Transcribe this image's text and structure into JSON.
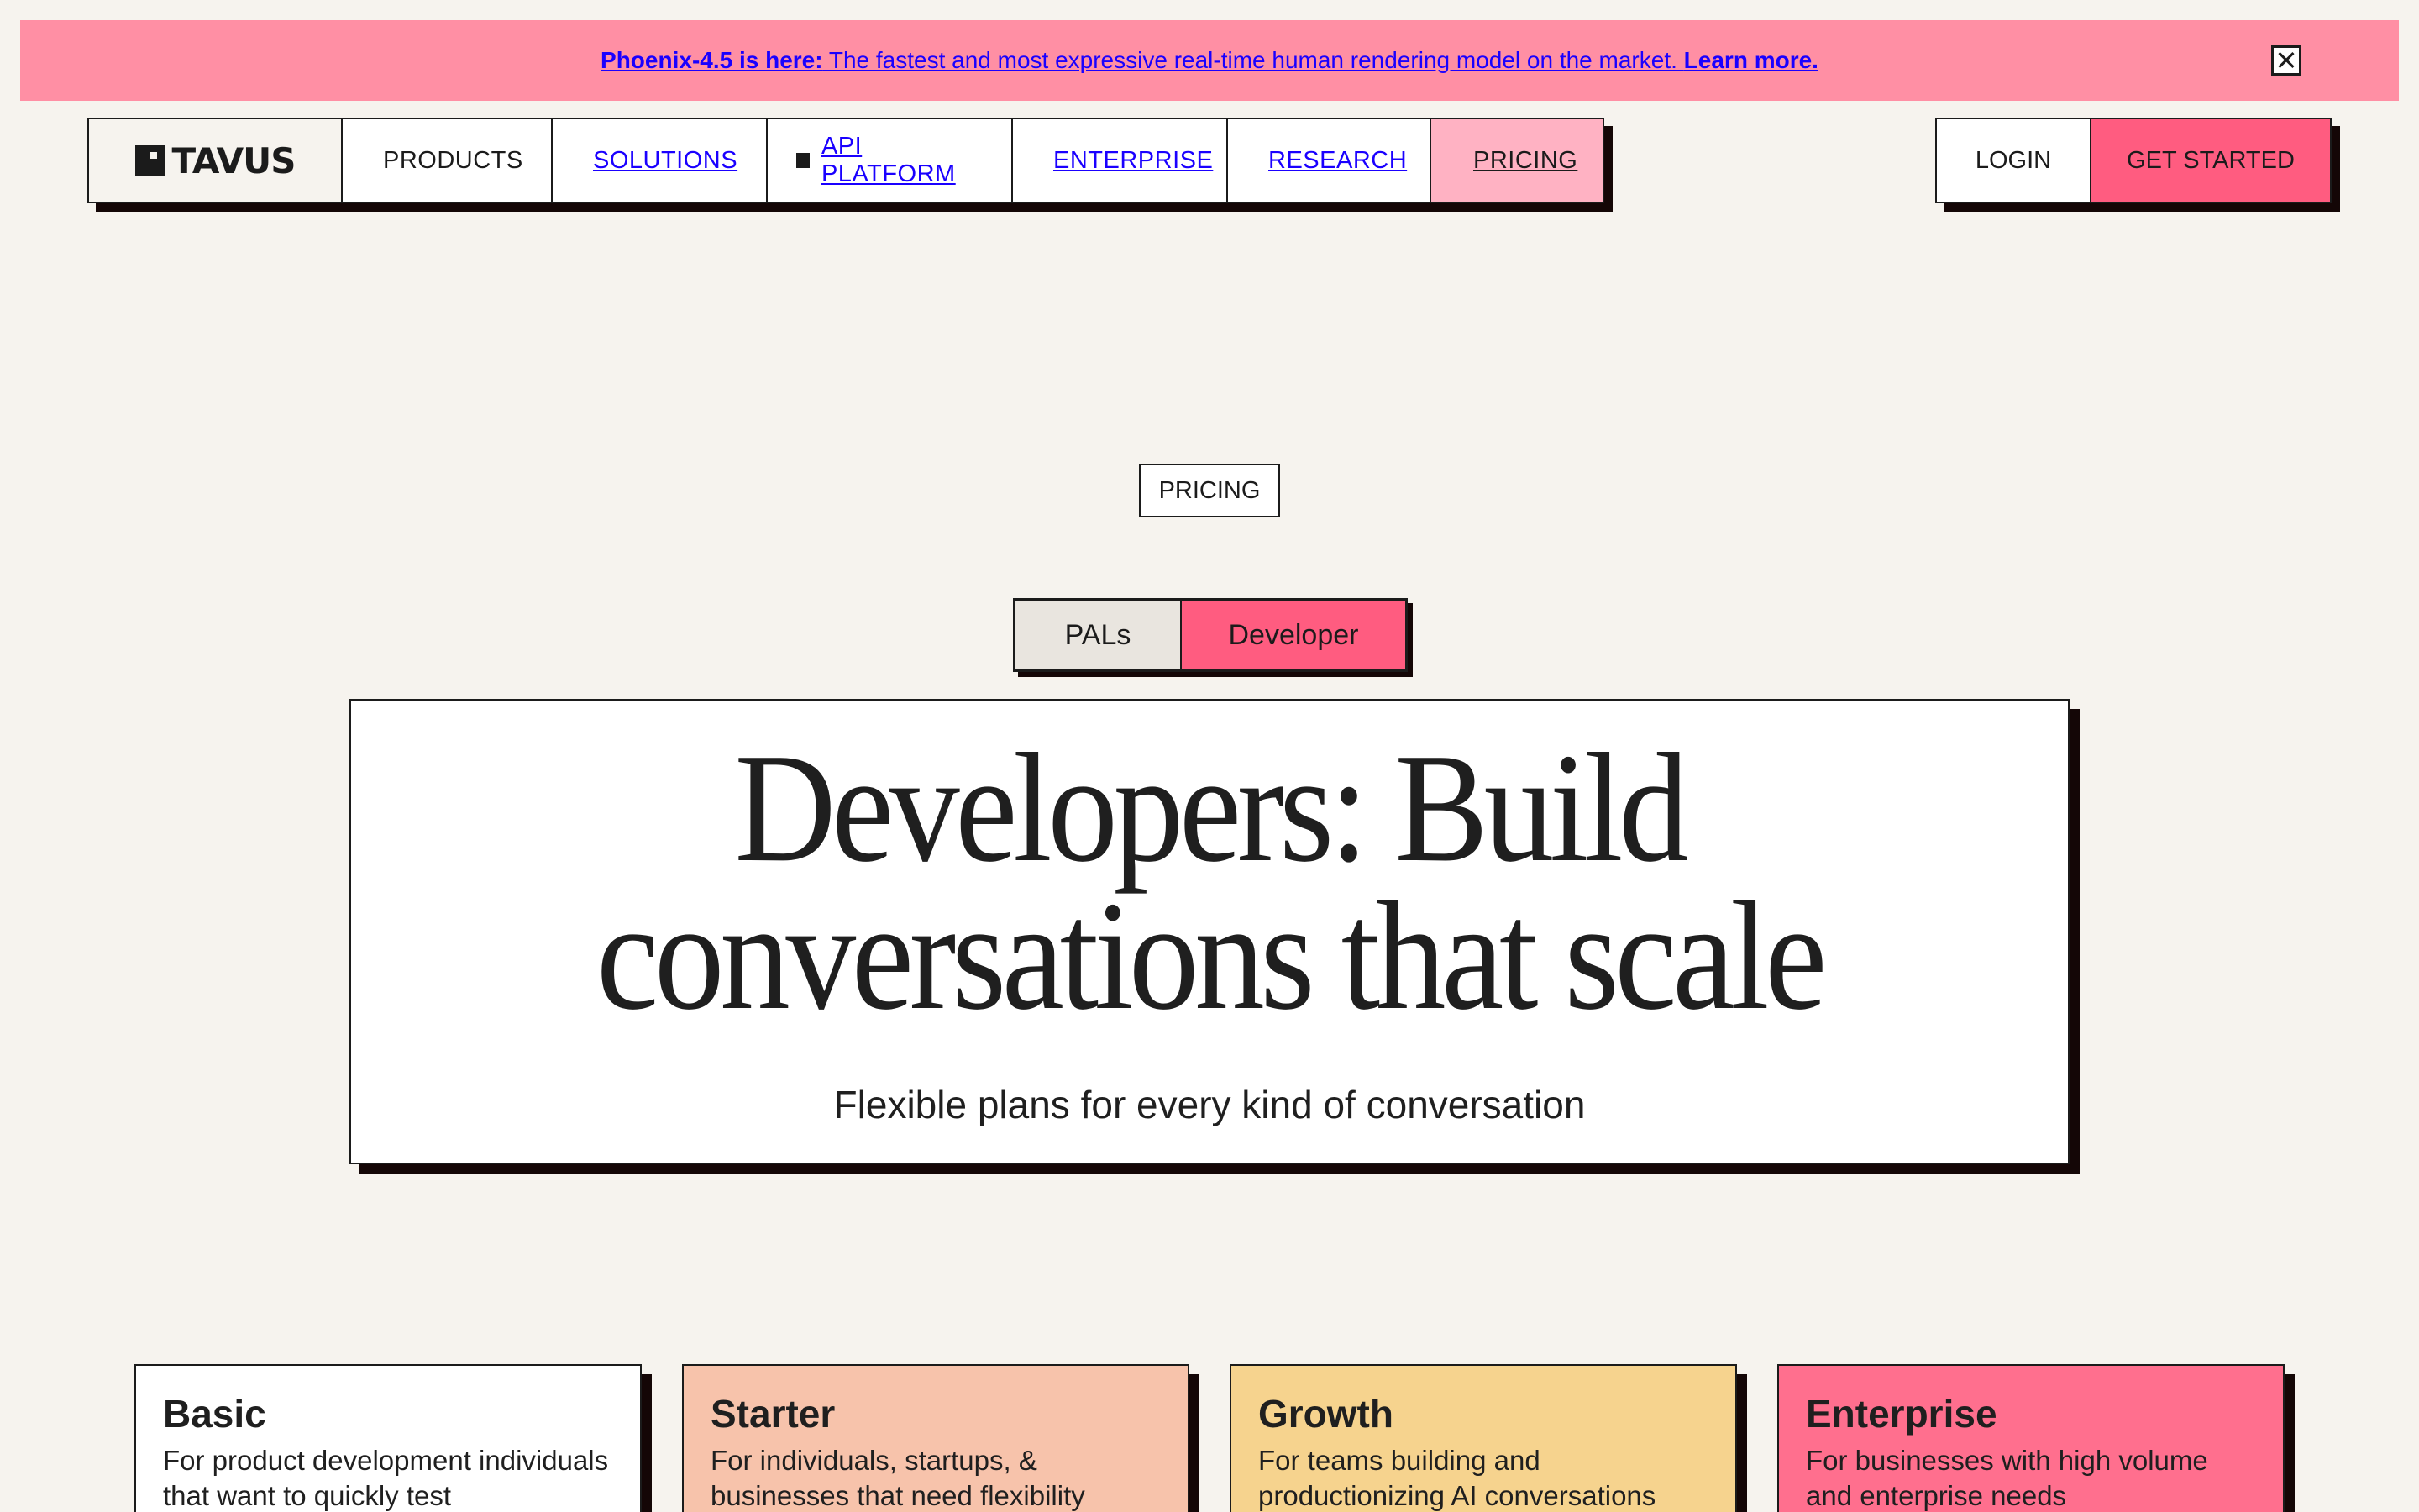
{
  "banner": {
    "lead": "Phoenix-4.5 is here:",
    "text": " The fastest and most expressive real-time human rendering model on the market. ",
    "cta": "Learn more.",
    "close_icon": "close-box-icon",
    "color": "#ff8fa4"
  },
  "nav": {
    "logo": "TAVUS",
    "items": [
      {
        "label": "PRODUCTS"
      },
      {
        "label": "SOLUTIONS"
      },
      {
        "label": "API PLATFORM"
      },
      {
        "label": "ENTERPRISE"
      },
      {
        "label": "RESEARCH"
      },
      {
        "label": "PRICING"
      }
    ],
    "login": "LOGIN",
    "get_started": "GET STARTED"
  },
  "page": {
    "tag": "PRICING",
    "toggle": [
      "PALs",
      "Developer"
    ],
    "selected_toggle": "Developer",
    "title_line1": "Developers: Build",
    "title_line2": "conversations that scale",
    "subtitle": "Flexible plans for every kind of conversation"
  },
  "plans": [
    {
      "name": "Basic",
      "desc": "For product development individuals that want to quickly test",
      "color": "#ffffff"
    },
    {
      "name": "Starter",
      "desc": "For individuals, startups, & businesses that need flexibility",
      "color": "#f7c3ab"
    },
    {
      "name": "Growth",
      "desc": "For teams building and productionizing AI conversations",
      "color": "#f6d38e"
    },
    {
      "name": "Enterprise",
      "desc": "For businesses with high volume and enterprise needs",
      "color": "#ff6f8e"
    }
  ],
  "colors": {
    "accent": "#ff5c80",
    "background": "#f6f3ee",
    "link": "#1a00ff"
  }
}
